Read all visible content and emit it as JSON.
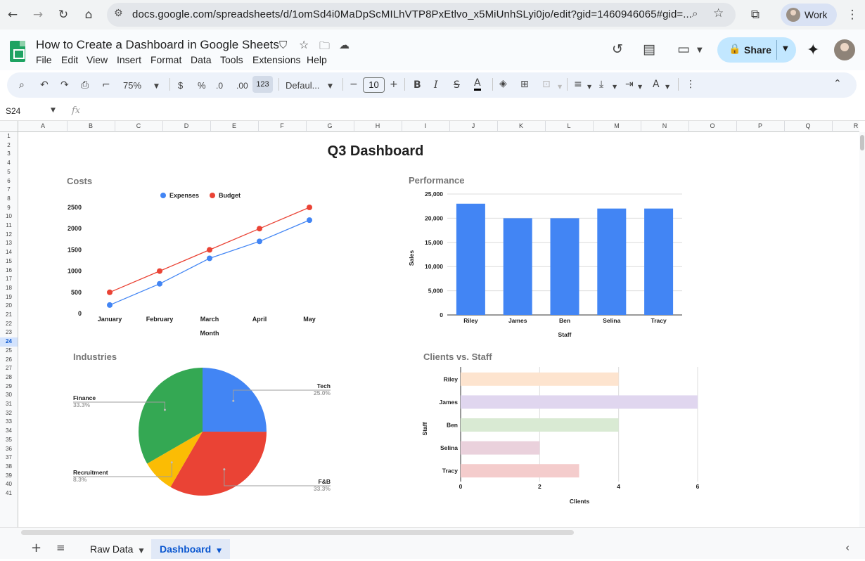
{
  "browser": {
    "url": "docs.google.com/spreadsheets/d/1omSd4i0MaDpScMILhVTP8PxEtlvo_x5MiUnhSLyi0jo/edit?gid=1460946065#gid=...",
    "profile_label": "Work"
  },
  "app": {
    "title": "How to Create a Dashboard in Google Sheets",
    "menu": [
      "File",
      "Edit",
      "View",
      "Insert",
      "Format",
      "Data",
      "Tools",
      "Extensions",
      "Help"
    ],
    "share_label": "Share"
  },
  "toolbar": {
    "zoom": "75%",
    "currency": "$",
    "percent": "%",
    "decrease_decimal": ".0",
    "increase_decimal": ".00",
    "number_format": "123",
    "font": "Defaul...",
    "font_size": "10"
  },
  "formula_bar": {
    "cell_ref": "S24",
    "fx": "fx",
    "formula": ""
  },
  "grid": {
    "columns": [
      "A",
      "B",
      "C",
      "D",
      "E",
      "F",
      "G",
      "H",
      "I",
      "J",
      "K",
      "L",
      "M",
      "N",
      "O",
      "P",
      "Q",
      "R"
    ],
    "rows": [
      "1",
      "2",
      "3",
      "4",
      "5",
      "6",
      "7",
      "8",
      "9",
      "10",
      "11",
      "12",
      "13",
      "14",
      "15",
      "16",
      "17",
      "18",
      "19",
      "20",
      "21",
      "22",
      "23",
      "24",
      "25",
      "26",
      "27",
      "28",
      "29",
      "30",
      "31",
      "32",
      "33",
      "34",
      "35",
      "36",
      "37",
      "38",
      "39",
      "40",
      "41"
    ],
    "selected_row": "24"
  },
  "dashboard_title": "Q3 Dashboard",
  "sheet_tabs": [
    {
      "label": "Raw Data",
      "active": false
    },
    {
      "label": "Dashboard",
      "active": true
    }
  ],
  "colors": {
    "blue": "#4285f4",
    "red": "#ea4335",
    "yellow": "#fbbc04",
    "green": "#34a853",
    "accent": "#0b57d0"
  },
  "chart_data": [
    {
      "type": "line",
      "title": "Costs",
      "xlabel": "Month",
      "ylabel": "",
      "categories": [
        "January",
        "February",
        "March",
        "April",
        "May"
      ],
      "series": [
        {
          "name": "Expenses",
          "values": [
            200,
            700,
            1300,
            1700,
            2200
          ],
          "color": "#4285f4"
        },
        {
          "name": "Budget",
          "values": [
            500,
            1000,
            1500,
            2000,
            2500
          ],
          "color": "#ea4335"
        }
      ],
      "ylim": [
        0,
        2500
      ],
      "yticks": [
        "0",
        "500",
        "1000",
        "1500",
        "2000",
        "2500"
      ],
      "legend": "top"
    },
    {
      "type": "bar",
      "title": "Performance",
      "xlabel": "Staff",
      "ylabel": "Sales",
      "categories": [
        "Riley",
        "James",
        "Ben",
        "Selina",
        "Tracy"
      ],
      "values": [
        23000,
        20000,
        20000,
        22000,
        22000
      ],
      "ylim": [
        0,
        25000
      ],
      "yticks": [
        "0",
        "5,000",
        "10,000",
        "15,000",
        "20,000",
        "25,000"
      ],
      "color": "#4285f4",
      "grid": true
    },
    {
      "type": "pie",
      "title": "Industries",
      "slices": [
        {
          "label": "Tech",
          "pct_label": "25.0%",
          "value": 25.0,
          "color": "#4285f4"
        },
        {
          "label": "F&B",
          "pct_label": "33.3%",
          "value": 33.3,
          "color": "#ea4335"
        },
        {
          "label": "Recruitment",
          "pct_label": "8.3%",
          "value": 8.3,
          "color": "#fbbc04"
        },
        {
          "label": "Finance",
          "pct_label": "33.3%",
          "value": 33.3,
          "color": "#34a853"
        }
      ]
    },
    {
      "type": "bar",
      "orientation": "horizontal",
      "title": "Clients vs. Staff",
      "xlabel": "Clients",
      "ylabel": "Staff",
      "categories": [
        "Riley",
        "James",
        "Ben",
        "Selina",
        "Tracy"
      ],
      "values": [
        4,
        6,
        4,
        2,
        3
      ],
      "colors": [
        "#fde4cf",
        "#e0d6ef",
        "#d9ead3",
        "#ead1dc",
        "#f4cccc"
      ],
      "xlim": [
        0,
        6
      ],
      "xticks": [
        "0",
        "2",
        "4",
        "6"
      ],
      "grid": true
    }
  ]
}
